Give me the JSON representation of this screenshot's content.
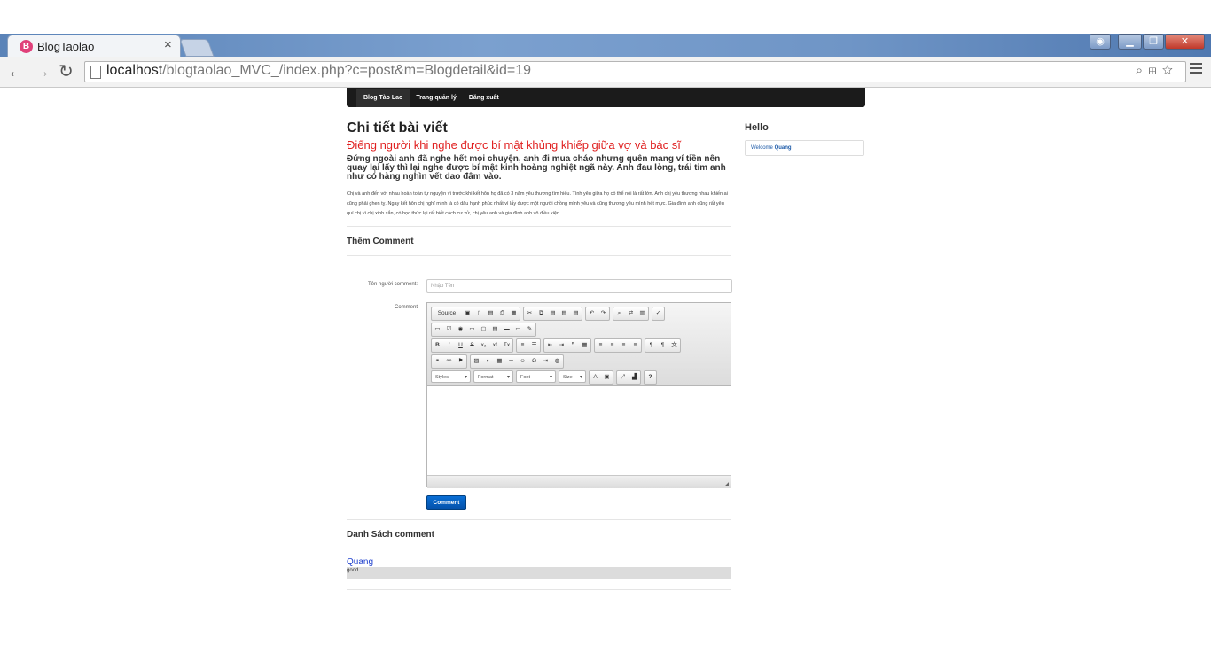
{
  "browser": {
    "tab_title": "BlogTaolao",
    "tab_close": "×",
    "url_host": "localhost",
    "url_path": "/blogtaolao_MVC_/index.php?c=post&m=Blogdetail&id=19",
    "back_icon": "←",
    "forward_icon": "→",
    "reload_icon": "↻"
  },
  "navbar": {
    "items": [
      "Blog Tào Lao",
      "Trang quản lý",
      "Đăng xuất"
    ]
  },
  "post": {
    "heading": "Chi tiết bài viết",
    "title": "Điếng người khi nghe được bí mật khủng khiếp giữa vợ và bác sĩ",
    "summary": "Đứng ngoài anh đã nghe hết mọi chuyện, anh đi mua cháo nhưng quên mang ví tiền nên quay lại lấy thì lại nghe được bí mật kinh hoàng nghiệt ngã này. Anh đau lòng, trái tim anh như có hàng nghìn vết dao đâm vào.",
    "body": "Chị và anh đến với nhau hoàn toàn tự nguyện vì trước khi kết hôn họ đã có 3 năm yêu thương tìm hiểu. Tình yêu giữa họ có thể nói là rất lớn. Anh chị yêu thương nhau khiến ai cũng phải ghen tỵ. Ngay kết hôn chị nghĩ mình là cô dâu hạnh phúc nhất vì lấy được một người chồng mình yêu và cũng thương yêu mình hết mực. Gia đình anh cũng rất yêu quí chị vì chị xinh xắn, có học thức lại rất biết cách cư xử, chị yêu anh và gia đình anh vô điều kiện."
  },
  "comment_form": {
    "section_title": "Thêm Comment",
    "name_label": "Tên người comment:",
    "name_placeholder": "Nhập Tên",
    "comment_label": "Comment",
    "editor": {
      "source_label": "Source",
      "styles": "Styles",
      "format": "Format",
      "font": "Font",
      "size": "Size",
      "help": "?"
    },
    "submit_label": "Comment"
  },
  "comments": {
    "section_title": "Danh Sách comment",
    "items": [
      {
        "author": "Quang",
        "text": "good"
      }
    ]
  },
  "sidebar": {
    "title": "Hello",
    "welcome_prefix": "Welcome ",
    "username": "Quang"
  }
}
